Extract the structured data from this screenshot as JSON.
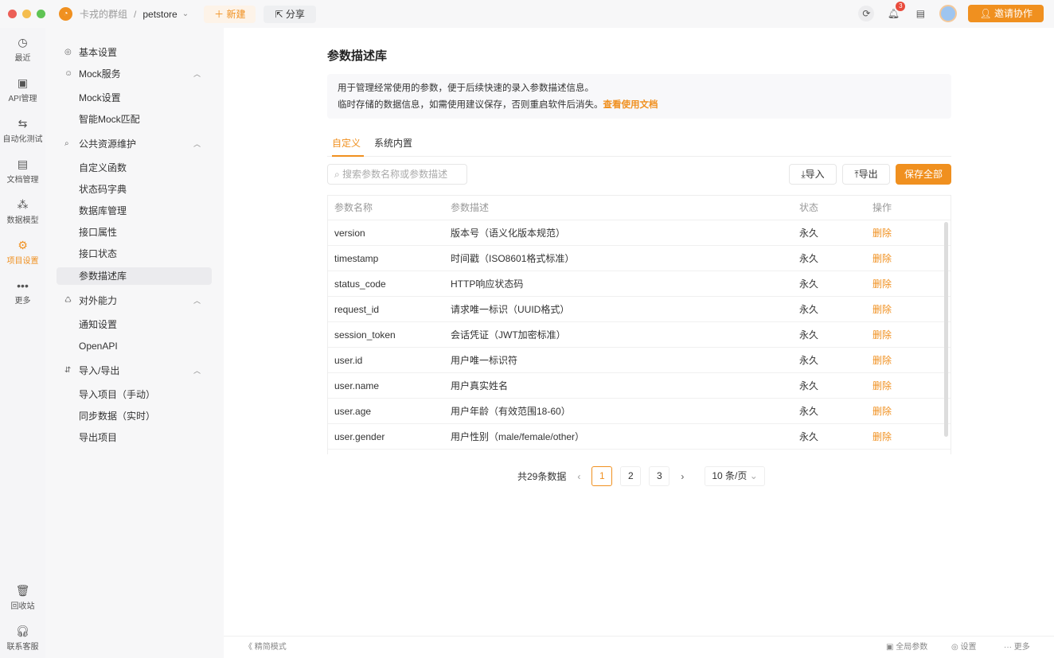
{
  "window": {
    "colors": {
      "close": "#ec5f57",
      "min": "#f4bd4f",
      "max": "#5fc454",
      "accent": "#f0901f"
    }
  },
  "topbar": {
    "team": "卡戎的群组",
    "separator": "/",
    "project": "petstore",
    "new_label": "新建",
    "share_label": "分享",
    "notif_count": "3",
    "invite_label": "邀请协作"
  },
  "rail": [
    {
      "label": "最近",
      "icon": "history-icon"
    },
    {
      "label": "API管理",
      "icon": "api-icon"
    },
    {
      "label": "自动化测试",
      "icon": "flow-icon"
    },
    {
      "label": "文档管理",
      "icon": "doc-icon"
    },
    {
      "label": "数据模型",
      "icon": "model-icon"
    },
    {
      "label": "项目设置",
      "icon": "settings-icon"
    },
    {
      "label": "更多",
      "icon": "more-icon"
    },
    {
      "label": "回收站",
      "icon": "trash-icon"
    },
    {
      "label": "联系客服",
      "icon": "headset-icon"
    }
  ],
  "submenu": {
    "basic": "基本设置",
    "mock": "Mock服务",
    "mock_items": [
      "Mock设置",
      "智能Mock匹配"
    ],
    "public": "公共资源维护",
    "public_items": [
      "自定义函数",
      "状态码字典",
      "数据库管理",
      "接口属性",
      "接口状态",
      "参数描述库"
    ],
    "external": "对外能力",
    "external_items": [
      "通知设置",
      "OpenAPI"
    ],
    "io": "导入/导出",
    "io_items": [
      "导入项目（手动）",
      "同步数据（实时）",
      "导出项目"
    ]
  },
  "main": {
    "title": "参数描述库",
    "note_line1": "用于管理经常使用的参数，便于后续快速的录入参数描述信息。",
    "note_line2": "临时存储的数据信息，如需使用建议保存，否则重启软件后消失。",
    "note_link": "查看使用文档",
    "tabs": [
      "自定义",
      "系统内置"
    ],
    "search_placeholder": "搜索参数名称或参数描述",
    "import_label": "导入",
    "export_label": "导出",
    "save_label": "保存全部",
    "columns": [
      "参数名称",
      "参数描述",
      "状态",
      "操作"
    ],
    "rows": [
      {
        "name": "version",
        "desc": "版本号（语义化版本规范）",
        "status": "永久",
        "action": "删除"
      },
      {
        "name": "timestamp",
        "desc": "时间戳（ISO8601格式标准）",
        "status": "永久",
        "action": "删除"
      },
      {
        "name": "status_code",
        "desc": "HTTP响应状态码",
        "status": "永久",
        "action": "删除"
      },
      {
        "name": "request_id",
        "desc": "请求唯一标识（UUID格式）",
        "status": "永久",
        "action": "删除"
      },
      {
        "name": "session_token",
        "desc": "会话凭证（JWT加密标准）",
        "status": "永久",
        "action": "删除"
      },
      {
        "name": "user.id",
        "desc": "用户唯一标识符",
        "status": "永久",
        "action": "删除"
      },
      {
        "name": "user.name",
        "desc": "用户真实姓名",
        "status": "永久",
        "action": "删除"
      },
      {
        "name": "user.age",
        "desc": "用户年龄（有效范围18-60）",
        "status": "永久",
        "action": "删除"
      },
      {
        "name": "user.gender",
        "desc": "用户性别（male/female/other）",
        "status": "永久",
        "action": "删除"
      }
    ],
    "pagination": {
      "total": "共29条数据",
      "pages": [
        "1",
        "2",
        "3"
      ],
      "current": "1",
      "per_page": "10 条/页"
    }
  },
  "footer": {
    "compact": "精简模式",
    "global_params": "全局参数",
    "settings": "设置",
    "more": "更多"
  }
}
